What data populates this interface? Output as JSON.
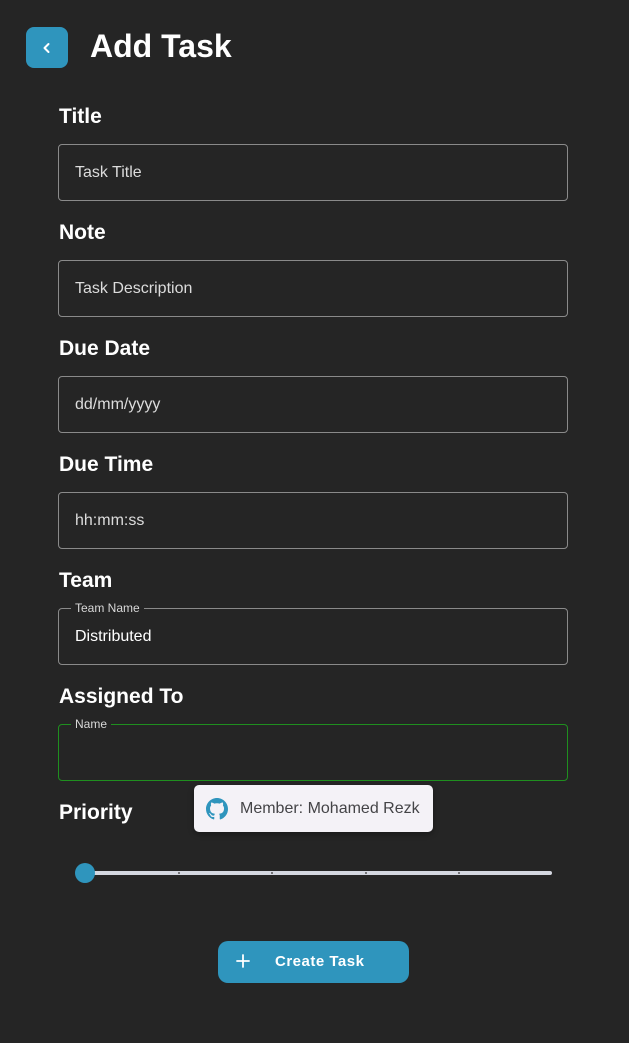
{
  "header": {
    "title": "Add Task",
    "back_icon": "chevron-left-icon"
  },
  "form": {
    "title": {
      "label": "Title",
      "placeholder": "Task Title"
    },
    "note": {
      "label": "Note",
      "placeholder": "Task Description"
    },
    "due_date": {
      "label": "Due Date",
      "placeholder": "dd/mm/yyyy"
    },
    "due_time": {
      "label": "Due Time",
      "placeholder": "hh:mm:ss"
    },
    "team": {
      "label": "Team",
      "floating_label": "Team Name",
      "value": "Distributed"
    },
    "assigned_to": {
      "label": "Assigned To",
      "floating_label": "Name",
      "value": ""
    },
    "priority": {
      "label": "Priority",
      "value": 0,
      "min": 0,
      "max": 5,
      "steps": 5
    }
  },
  "suggestion": {
    "icon": "github-icon",
    "text": "Member: Mohamed Rezk"
  },
  "actions": {
    "create_label": "Create Task",
    "create_icon": "plus-icon"
  },
  "colors": {
    "background": "#252525",
    "accent": "#2f95bd",
    "focus_border": "#1f8f1f"
  }
}
